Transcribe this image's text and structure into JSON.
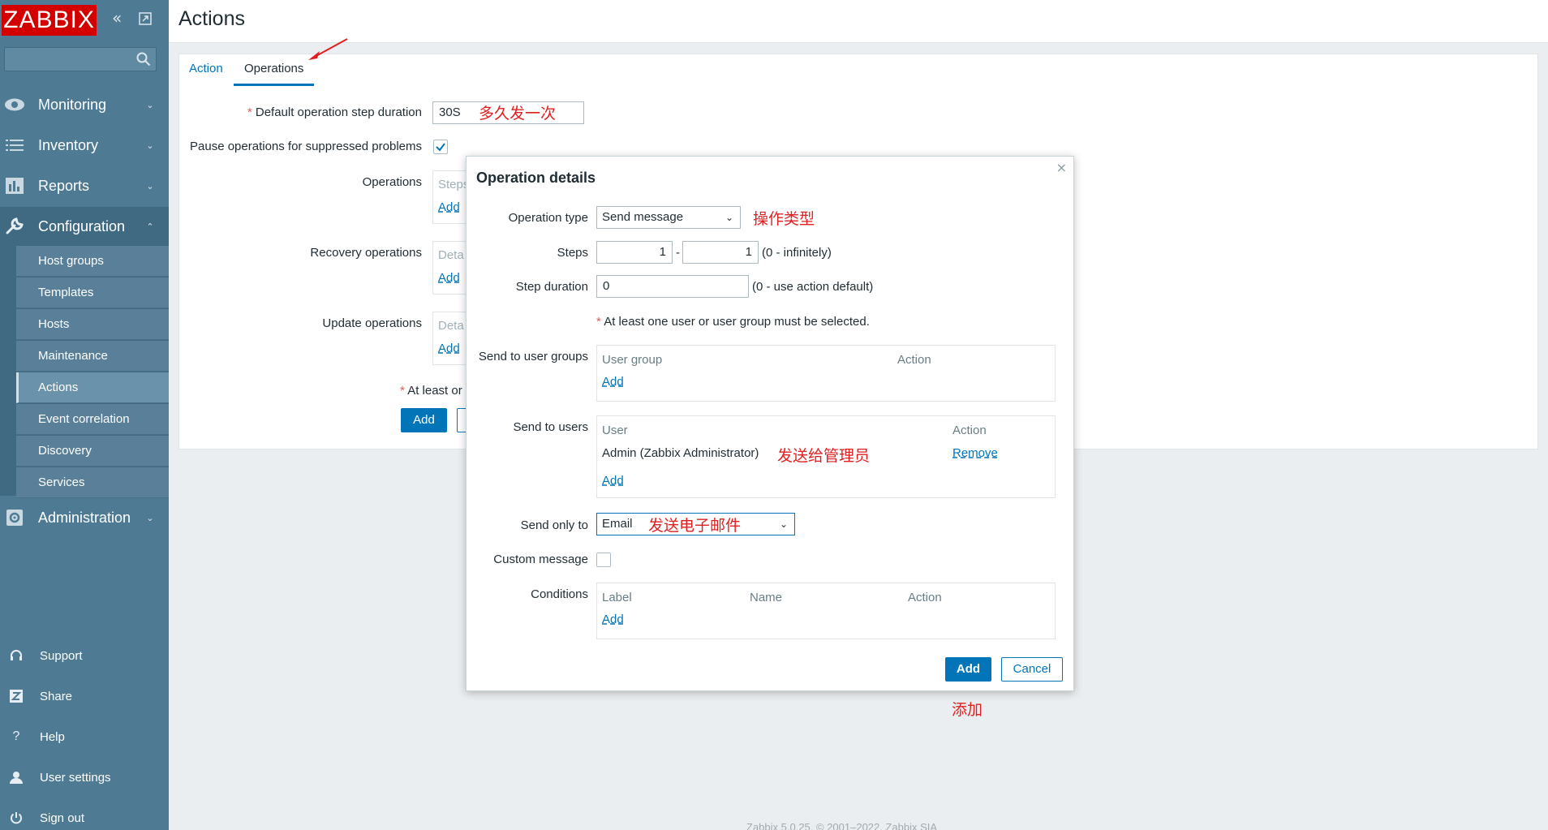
{
  "sidebar": {
    "logo": "ZABBIX",
    "menu": {
      "monitoring": "Monitoring",
      "inventory": "Inventory",
      "reports": "Reports",
      "configuration": "Configuration",
      "administration": "Administration"
    },
    "submenu": [
      "Host groups",
      "Templates",
      "Hosts",
      "Maintenance",
      "Actions",
      "Event correlation",
      "Discovery",
      "Services"
    ],
    "footer": {
      "support": "Support",
      "share": "Share",
      "help": "Help",
      "user_settings": "User settings",
      "sign_out": "Sign out"
    }
  },
  "header": {
    "title": "Actions"
  },
  "tabs": {
    "action": "Action",
    "operations": "Operations"
  },
  "form": {
    "step_duration_label": "Default operation step duration",
    "step_duration_value": "30S",
    "step_duration_note": "多久发一次",
    "pause_label": "Pause operations for suppressed problems",
    "operations_label": "Operations",
    "operations_header": "Steps",
    "recovery_label": "Recovery operations",
    "update_label": "Update operations",
    "details_header": "Deta",
    "add_link": "Add",
    "at_least_note": "At least or",
    "add_button": "Add"
  },
  "dialog": {
    "title": "Operation details",
    "close": "×",
    "operation_type_label": "Operation type",
    "operation_type_value": "Send message",
    "operation_type_note": "操作类型",
    "steps_label": "Steps",
    "steps_from": "1",
    "steps_to": "1",
    "steps_separator": "-",
    "steps_hint": "(0 - infinitely)",
    "step_duration_label": "Step duration",
    "step_duration_value": "0",
    "step_duration_hint": "(0 - use action default)",
    "required_note": "At least one user or user group must be selected.",
    "user_groups_label": "Send to user groups",
    "user_groups_col_group": "User group",
    "user_groups_col_action": "Action",
    "users_label": "Send to users",
    "users_col_user": "User",
    "users_col_action": "Action",
    "user_row_name": "Admin (Zabbix Administrator)",
    "user_row_note": "发送给管理员",
    "user_row_remove": "Remove",
    "send_only_label": "Send only to",
    "send_only_value": "Email",
    "send_only_note": "发送电子邮件",
    "custom_message_label": "Custom message",
    "conditions_label": "Conditions",
    "conditions_col_label": "Label",
    "conditions_col_name": "Name",
    "conditions_col_action": "Action",
    "add_link": "Add",
    "add_button": "Add",
    "cancel_button": "Cancel",
    "add_note": "添加"
  },
  "footer": {
    "copyright": "Zabbix 5.0.25. © 2001–2022, Zabbix SIA"
  }
}
